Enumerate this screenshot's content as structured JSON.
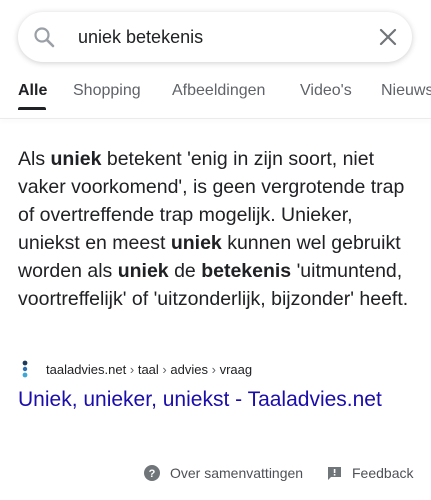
{
  "search": {
    "query": "uniek betekenis"
  },
  "tabs": [
    {
      "label": "Alle"
    },
    {
      "label": "Shopping"
    },
    {
      "label": "Afbeeldingen"
    },
    {
      "label": "Video's"
    },
    {
      "label": "Nieuws"
    }
  ],
  "snippet": {
    "parts": [
      {
        "text": "Als ",
        "bold": false
      },
      {
        "text": "uniek",
        "bold": true
      },
      {
        "text": " betekent 'enig in zijn soort, niet vaker voorkomend', is geen vergrotende trap of overtreffende trap mogelijk. Unieker, uniekst en meest ",
        "bold": false
      },
      {
        "text": "uniek",
        "bold": true
      },
      {
        "text": " kunnen wel gebruikt worden als ",
        "bold": false
      },
      {
        "text": "uniek",
        "bold": true
      },
      {
        "text": " de ",
        "bold": false
      },
      {
        "text": "betekenis",
        "bold": true
      },
      {
        "text": " 'uitmuntend, voortreffelijk' of 'uitzonderlijk, bijzonder' heeft.",
        "bold": false
      }
    ]
  },
  "source": {
    "site": "taaladvies.net",
    "path": [
      "taal",
      "advies",
      "vraag"
    ],
    "separator": "›"
  },
  "result": {
    "title": "Uniek, unieker, uniekst - Taaladvies.net"
  },
  "footer": {
    "about_label": "Over samenvattingen",
    "feedback_label": "Feedback"
  },
  "colors": {
    "link": "#1a0dab",
    "text": "#202124",
    "muted": "#5f6368"
  }
}
